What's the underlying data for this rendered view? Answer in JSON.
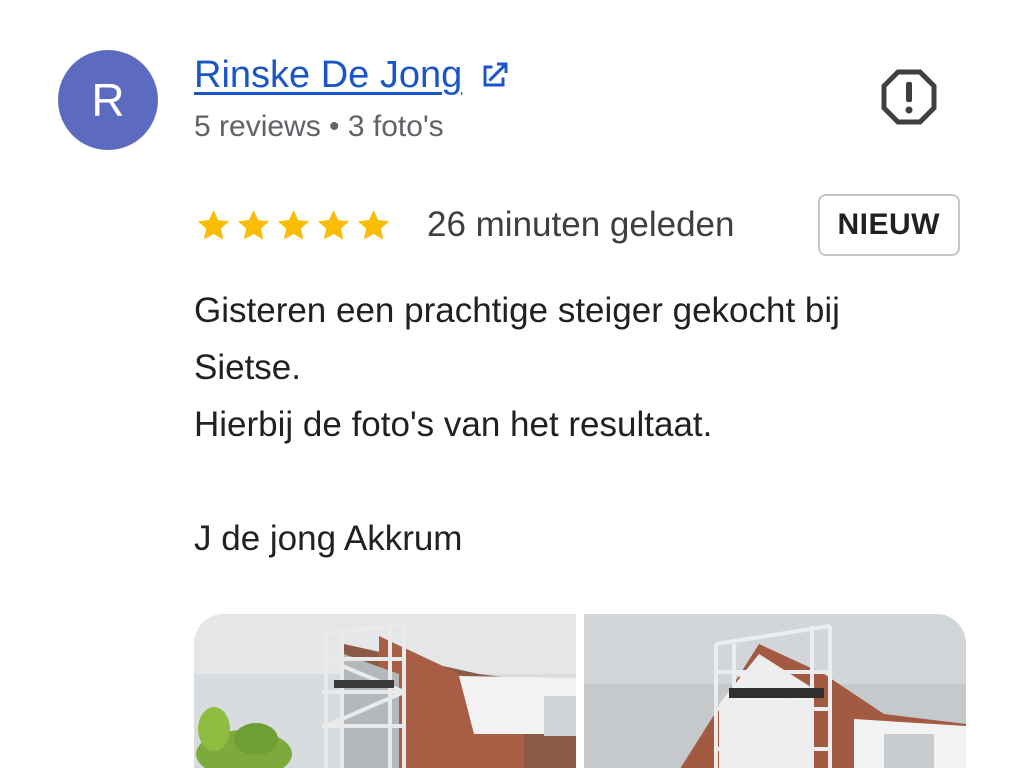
{
  "reviewer": {
    "initial": "R",
    "name": "Rinske De Jong",
    "meta": "5 reviews • 3 foto's",
    "avatar_color": "#5c6bc0",
    "external_link_icon": "open-in-new-icon",
    "report_icon": "report-flag-icon"
  },
  "review": {
    "rating": 5,
    "rating_max": 5,
    "star_color": "#fbbc04",
    "time": "26 minuten geleden",
    "badge": "NIEUW",
    "text_lines": [
      "Gisteren een prachtige steiger gekocht bij",
      "Sietse.",
      "Hierbij de foto's van het resultaat.",
      "J de jong Akkrum"
    ]
  },
  "photos": [
    {
      "icon": "scaffold-house-photo"
    },
    {
      "icon": "scaffold-house-photo"
    }
  ],
  "colors": {
    "link": "#1a56c8",
    "secondary_text": "#5f6368",
    "primary_text": "#202124"
  }
}
